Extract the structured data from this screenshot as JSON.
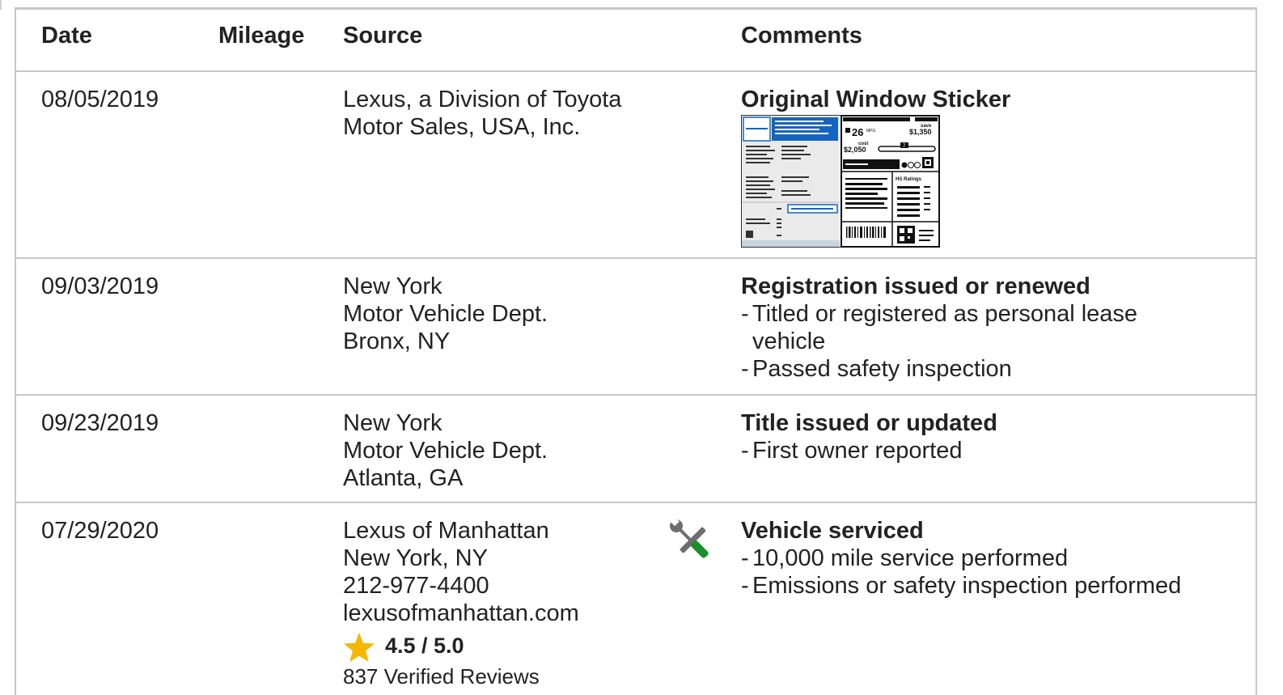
{
  "header": {
    "date": "Date",
    "mileage": "Mileage",
    "source": "Source",
    "comments": "Comments"
  },
  "rows": [
    {
      "date": "08/05/2019",
      "source": [
        "Lexus, a Division of Toyota",
        "Motor Sales, USA, Inc."
      ],
      "comment_title": "Original Window Sticker",
      "sticker": {
        "mpg": "26",
        "mpg_unit": "MPG",
        "save_label": "save",
        "save": "$1,350",
        "cost_label": "cost",
        "cost": "$2,050",
        "ratings_label": "HS Ratings",
        "dial_value": "7"
      }
    },
    {
      "date": "09/03/2019",
      "source": [
        "New York",
        "Motor Vehicle Dept.",
        "Bronx, NY"
      ],
      "comment_title": "Registration issued or renewed",
      "bullets": [
        "Titled or registered as personal lease",
        "vehicle",
        "Passed safety inspection"
      ]
    },
    {
      "date": "09/23/2019",
      "source": [
        "New York",
        "Motor Vehicle Dept.",
        "Atlanta, GA"
      ],
      "comment_title": "Title issued or updated",
      "bullets": [
        "First owner reported"
      ]
    },
    {
      "date": "07/29/2020",
      "source": [
        "Lexus of Manhattan",
        "New York, NY",
        "212-977-4400",
        "lexusofmanhattan.com"
      ],
      "rating": "4.5 / 5.0",
      "reviews": "837 Verified Reviews",
      "comment_title": "Vehicle serviced",
      "bullets": [
        "10,000 mile service performed",
        "Emissions or safety inspection performed"
      ],
      "icon": "wrench-screwdriver-icon"
    }
  ],
  "colors": {
    "border": "#c7c7c7",
    "text": "#222222",
    "star": "#f5b800",
    "sticker_blue": "#1565c0",
    "icon_gray": "#6d6d6d",
    "icon_green": "#1b8e2d"
  }
}
